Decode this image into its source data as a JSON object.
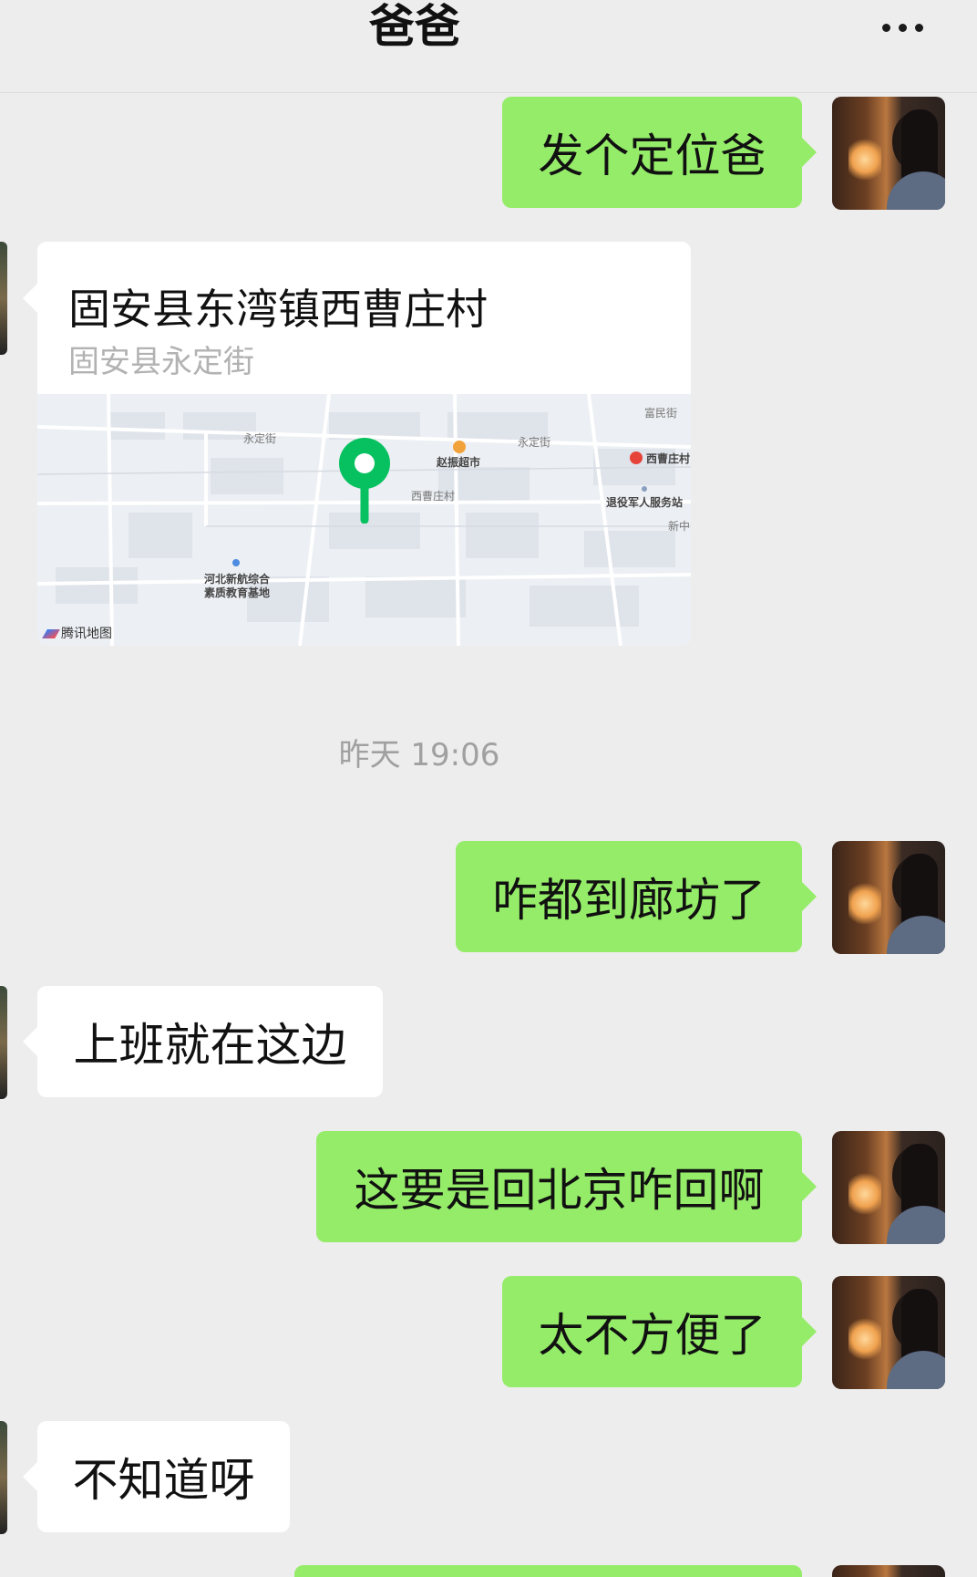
{
  "header": {
    "title": "爸爸",
    "more_icon": "more-dots-icon"
  },
  "messages": [
    {
      "side": "me",
      "text": "发个定位爸"
    },
    {
      "side": "other",
      "type": "location",
      "location": {
        "name": "固安县东湾镇西曹庄村",
        "address": "固安县永定街",
        "map_labels": [
          "富民街",
          "永定街",
          "永定街",
          "赵振超市",
          "西曹庄村",
          "西曹庄村",
          "退役军人服务站",
          "新中",
          "河北新航综合",
          "素质教育基地"
        ],
        "watermark": "腾讯地图"
      }
    },
    {
      "type": "timestamp",
      "text": "昨天 19:06"
    },
    {
      "side": "me",
      "text": "咋都到廊坊了"
    },
    {
      "side": "other",
      "text": "上班就在这边"
    },
    {
      "side": "me",
      "text": "这要是回北京咋回啊"
    },
    {
      "side": "me",
      "text": "太不方便了"
    },
    {
      "side": "other",
      "text": "不知道呀"
    }
  ],
  "colors": {
    "background": "#ededed",
    "my_bubble": "#95ec69",
    "other_bubble": "#ffffff",
    "map_pin": "#07c160"
  }
}
